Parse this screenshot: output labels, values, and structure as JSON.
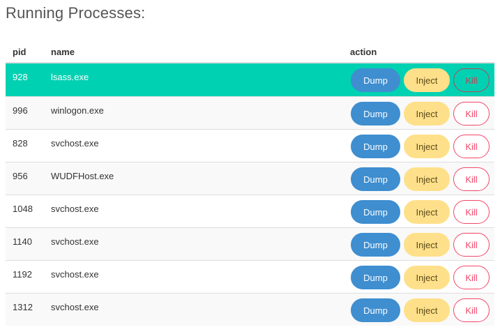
{
  "page": {
    "title": "Running Processes:"
  },
  "table": {
    "headers": {
      "pid": "pid",
      "name": "name",
      "action": "action"
    },
    "actions": {
      "dump": "Dump",
      "inject": "Inject",
      "kill": "Kill"
    },
    "rows": [
      {
        "pid": "928",
        "name": "lsass.exe",
        "selected": true
      },
      {
        "pid": "996",
        "name": "winlogon.exe",
        "selected": false
      },
      {
        "pid": "828",
        "name": "svchost.exe",
        "selected": false
      },
      {
        "pid": "956",
        "name": "WUDFHost.exe",
        "selected": false
      },
      {
        "pid": "1048",
        "name": "svchost.exe",
        "selected": false
      },
      {
        "pid": "1140",
        "name": "svchost.exe",
        "selected": false
      },
      {
        "pid": "1192",
        "name": "svchost.exe",
        "selected": false
      },
      {
        "pid": "1312",
        "name": "svchost.exe",
        "selected": false
      }
    ]
  },
  "colors": {
    "selected_row": "#00d1b2",
    "dump": "#3e8ed0",
    "inject": "#ffe08a",
    "kill": "#f14668"
  }
}
